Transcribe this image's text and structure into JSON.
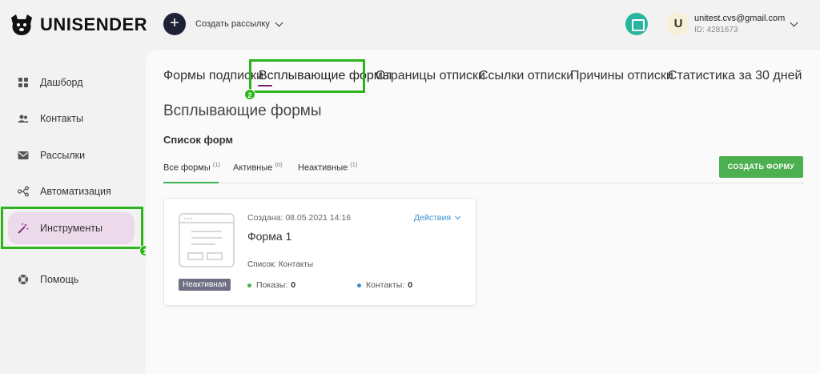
{
  "brand": {
    "name": "UNISENDER"
  },
  "header": {
    "create_button_symbol": "+",
    "create_label": "Создать рассылку",
    "user_initial": "U",
    "user_email": "unitest.cvs@gmail.com",
    "user_id": "ID: 4281673"
  },
  "sidebar": {
    "items": [
      {
        "label": "Дашборд",
        "icon": "dashboard-icon"
      },
      {
        "label": "Контакты",
        "icon": "contacts-icon"
      },
      {
        "label": "Рассылки",
        "icon": "mail-icon"
      },
      {
        "label": "Автоматизация",
        "icon": "automation-icon"
      },
      {
        "label": "Инструменты",
        "icon": "magic-wand-icon",
        "active": true
      },
      {
        "label": "Помощь",
        "icon": "help-lifebuoy-icon"
      }
    ],
    "highlight_badge": "1"
  },
  "tabs": {
    "items": [
      {
        "label": "Формы подписки"
      },
      {
        "label": "Всплывающие формы",
        "active": true
      },
      {
        "label": "Страницы отписки"
      },
      {
        "label": "Ссылки отписки"
      },
      {
        "label": "Причины отписки"
      },
      {
        "label": "Статистика за 30 дней"
      }
    ],
    "highlight_badge": "2"
  },
  "page": {
    "title": "Всплывающие формы",
    "section_title": "Список форм",
    "filters": [
      {
        "label": "Все формы",
        "count": "(1)",
        "active": true
      },
      {
        "label": "Активные",
        "count": "(0)"
      },
      {
        "label": "Неактивные",
        "count": "(1)"
      }
    ],
    "create_form_button": "СОЗДАТЬ ФОРМУ"
  },
  "form_card": {
    "created": "Создана: 08.05.2021 14:16",
    "actions_label": "Действия",
    "name": "Форма 1",
    "list": "Список: Контакты",
    "status": "Неактивная",
    "shows_label": "Показы:",
    "shows_value": "0",
    "contacts_label": "Контакты:",
    "contacts_value": "0"
  },
  "colors": {
    "accent_green": "#4caf50",
    "highlight_green": "#2bb51b",
    "active_nav_bg": "#ecdaea",
    "tab_underline": "#7b1a6f",
    "link_blue": "#3a8fd0",
    "help_teal": "#27b59f"
  }
}
